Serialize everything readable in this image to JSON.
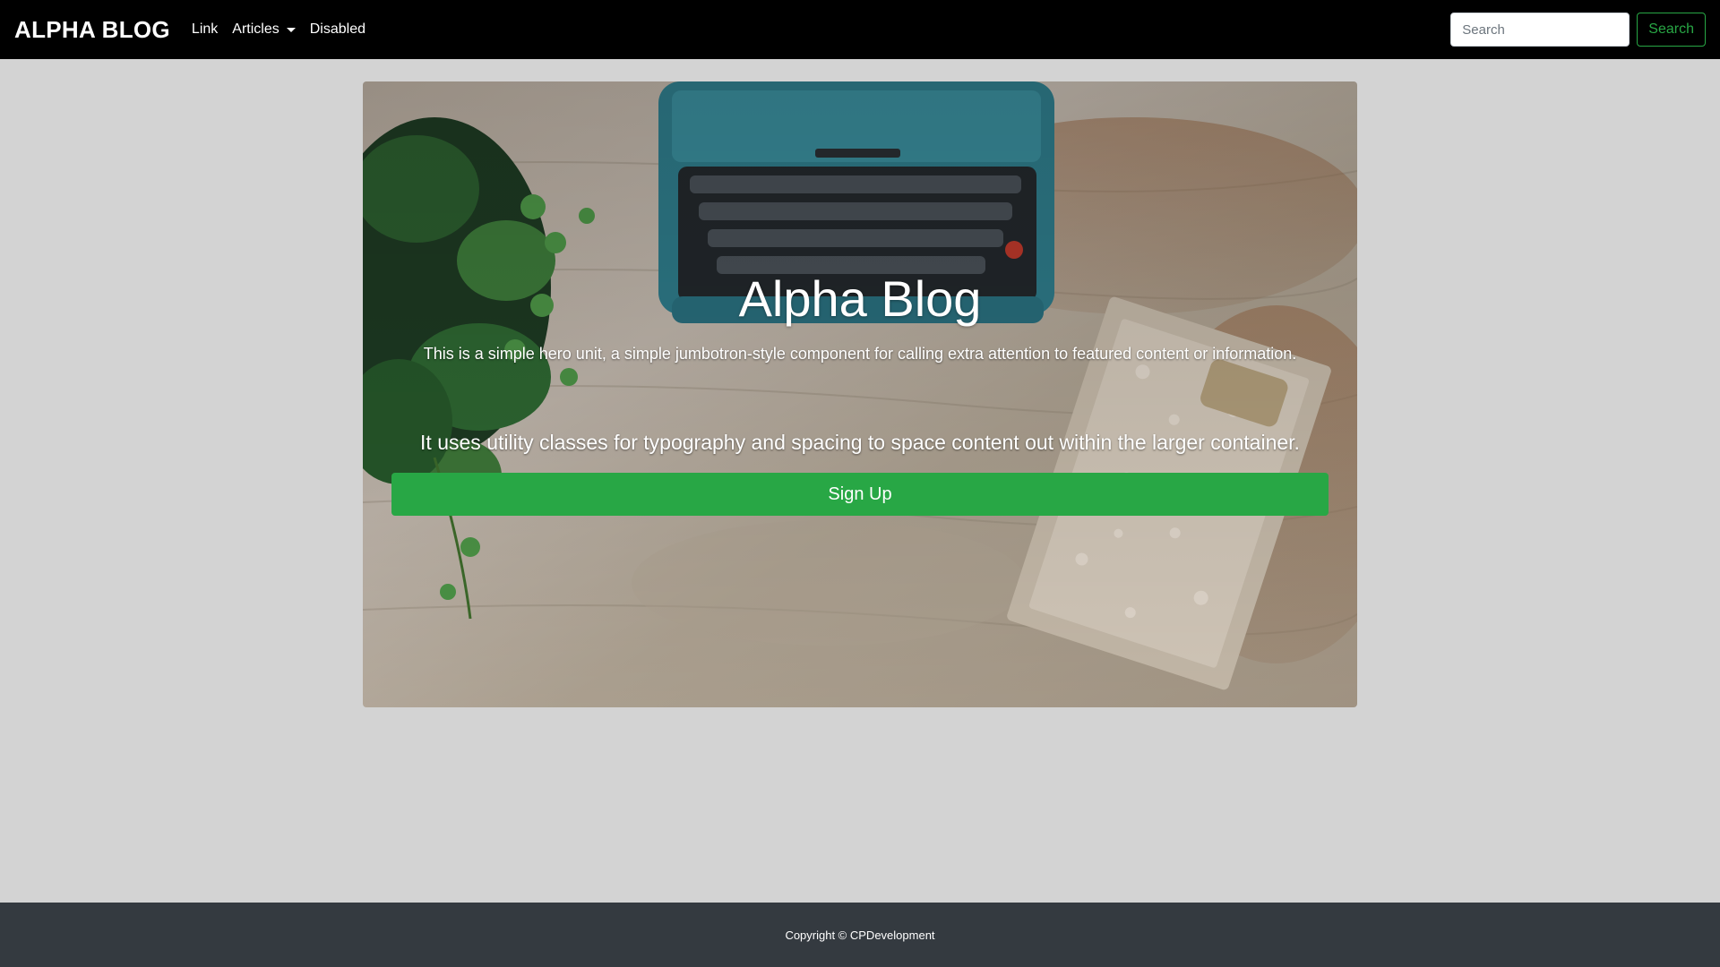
{
  "navbar": {
    "brand": "ALPHA BLOG",
    "links": [
      {
        "label": "Link"
      },
      {
        "label": "Articles"
      },
      {
        "label": "Disabled"
      }
    ],
    "search": {
      "placeholder": "Search",
      "button_label": "Search"
    }
  },
  "hero": {
    "title": "Alpha Blog",
    "lead": "This is a simple hero unit, a simple jumbotron-style component for calling extra attention to featured content or information.",
    "subtext": "It uses utility classes for typography and spacing to space content out within the larger container.",
    "signup_label": "Sign Up"
  },
  "footer": {
    "copyright": "Copyright © CPDevelopment"
  },
  "colors": {
    "navbar_bg": "#000000",
    "page_bg": "#d3d3d3",
    "accent_green": "#28a745",
    "footer_bg": "#343a40"
  }
}
